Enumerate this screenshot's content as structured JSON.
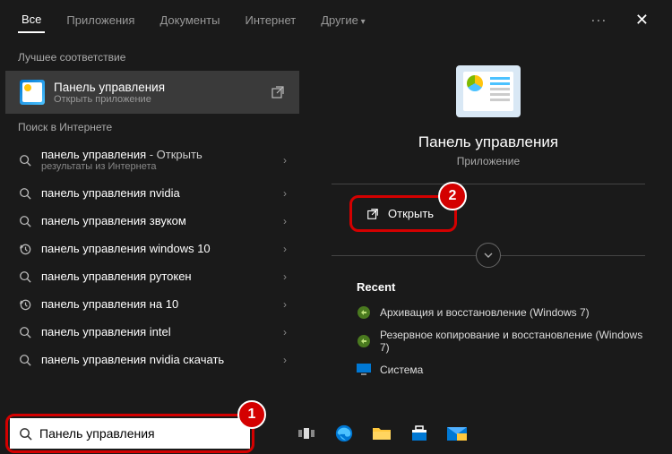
{
  "tabs": {
    "all": "Все",
    "apps": "Приложения",
    "docs": "Документы",
    "internet": "Интернет",
    "other": "Другие"
  },
  "left": {
    "best_match_header": "Лучшее соответствие",
    "best_match_title": "Панель управления",
    "best_match_sub": "Открыть приложение",
    "web_header": "Поиск в Интернете",
    "results": [
      {
        "kind": "search",
        "bold": "панель управления",
        "rest": " - Открыть",
        "sub": "результаты из Интернета"
      },
      {
        "kind": "search",
        "bold": "панель управления nvidia",
        "rest": ""
      },
      {
        "kind": "search",
        "bold": "панель управления звуком",
        "rest": ""
      },
      {
        "kind": "history",
        "bold": "панель управления windows 10",
        "rest": ""
      },
      {
        "kind": "search",
        "bold": "панель управления рутокен",
        "rest": ""
      },
      {
        "kind": "history",
        "bold": "панель управления на 10",
        "rest": ""
      },
      {
        "kind": "search",
        "bold": "панель управления intel",
        "rest": ""
      },
      {
        "kind": "search",
        "bold": "панель управления nvidia скачать",
        "rest": ""
      }
    ]
  },
  "right": {
    "title": "Панель управления",
    "subtitle": "Приложение",
    "open_label": "Открыть",
    "recent_header": "Recent",
    "recent": [
      "Архивация и восстановление (Windows 7)",
      "Резервное копирование и восстановление (Windows 7)",
      "Система"
    ]
  },
  "search_value": "Панель управления",
  "annotations": {
    "step1": "1",
    "step2": "2"
  }
}
